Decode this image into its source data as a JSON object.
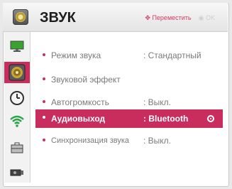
{
  "header": {
    "title": "ЗВУК",
    "hint_move_glyph": "✥",
    "hint_move": "Переместить",
    "hint_ok_glyph": "◉",
    "hint_ok": "OK",
    "icon": "speaker-icon"
  },
  "sidebar": {
    "items": [
      {
        "name": "picture",
        "icon": "monitor-icon"
      },
      {
        "name": "sound",
        "icon": "speaker-icon",
        "selected": true
      },
      {
        "name": "time",
        "icon": "clock-icon"
      },
      {
        "name": "network",
        "icon": "wifi-icon"
      },
      {
        "name": "options",
        "icon": "briefcase-icon"
      },
      {
        "name": "input",
        "icon": "projector-icon"
      }
    ]
  },
  "menu": {
    "items": [
      {
        "label": "Режим звука",
        "value": ": Стандартный"
      },
      {
        "label": "Звуковой эффект",
        "value": ""
      },
      {
        "label": "Автогромкость",
        "value": ": Выкл."
      },
      {
        "label": "Аудиовыход",
        "value": ": Bluetooth",
        "selected": true
      },
      {
        "label": "Синхронизация звука",
        "value": ": Выкл."
      }
    ]
  },
  "colors": {
    "accent": "#c82d5e",
    "text_inactive": "#7a7a7a"
  }
}
